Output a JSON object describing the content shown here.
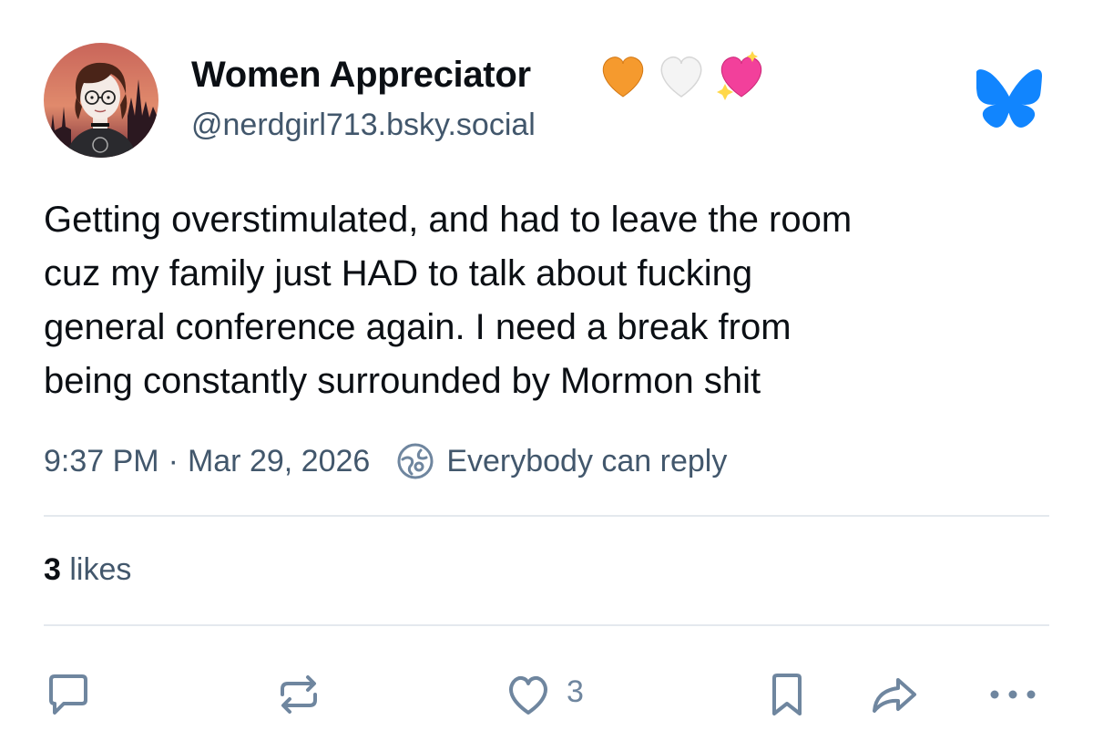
{
  "author": {
    "display_name": "Women Appreciator",
    "emoji_badges": [
      "orange-heart",
      "white-heart",
      "sparkling-heart"
    ],
    "handle": "@nerdgirl713.bsky.social",
    "avatar": "avatar-drawing"
  },
  "app_logo": "bluesky-butterfly-icon",
  "post": {
    "text": "Getting overstimulated, and had to leave the room\ncuz my family just HAD to talk about fucking\ngeneral conference again. I need a break from\nbeing constantly surrounded by Mormon shit",
    "time": "9:37 PM",
    "separator": "·",
    "date": "Mar 29, 2026",
    "reply_setting": "Everybody can reply"
  },
  "stats": {
    "likes_count": "3",
    "likes_label": " likes"
  },
  "actions": {
    "reply_icon": "reply-icon",
    "repost_icon": "repost-icon",
    "like_icon": "heart-icon",
    "like_count": "3",
    "bookmark_icon": "bookmark-icon",
    "share_icon": "share-icon",
    "more_icon": "more-icon"
  },
  "colors": {
    "text": "#0b0f14",
    "secondary_text": "#42576c",
    "icon": "#6f869f",
    "divider": "#e4e9ee",
    "bluesky_blue": "#1185fe"
  }
}
